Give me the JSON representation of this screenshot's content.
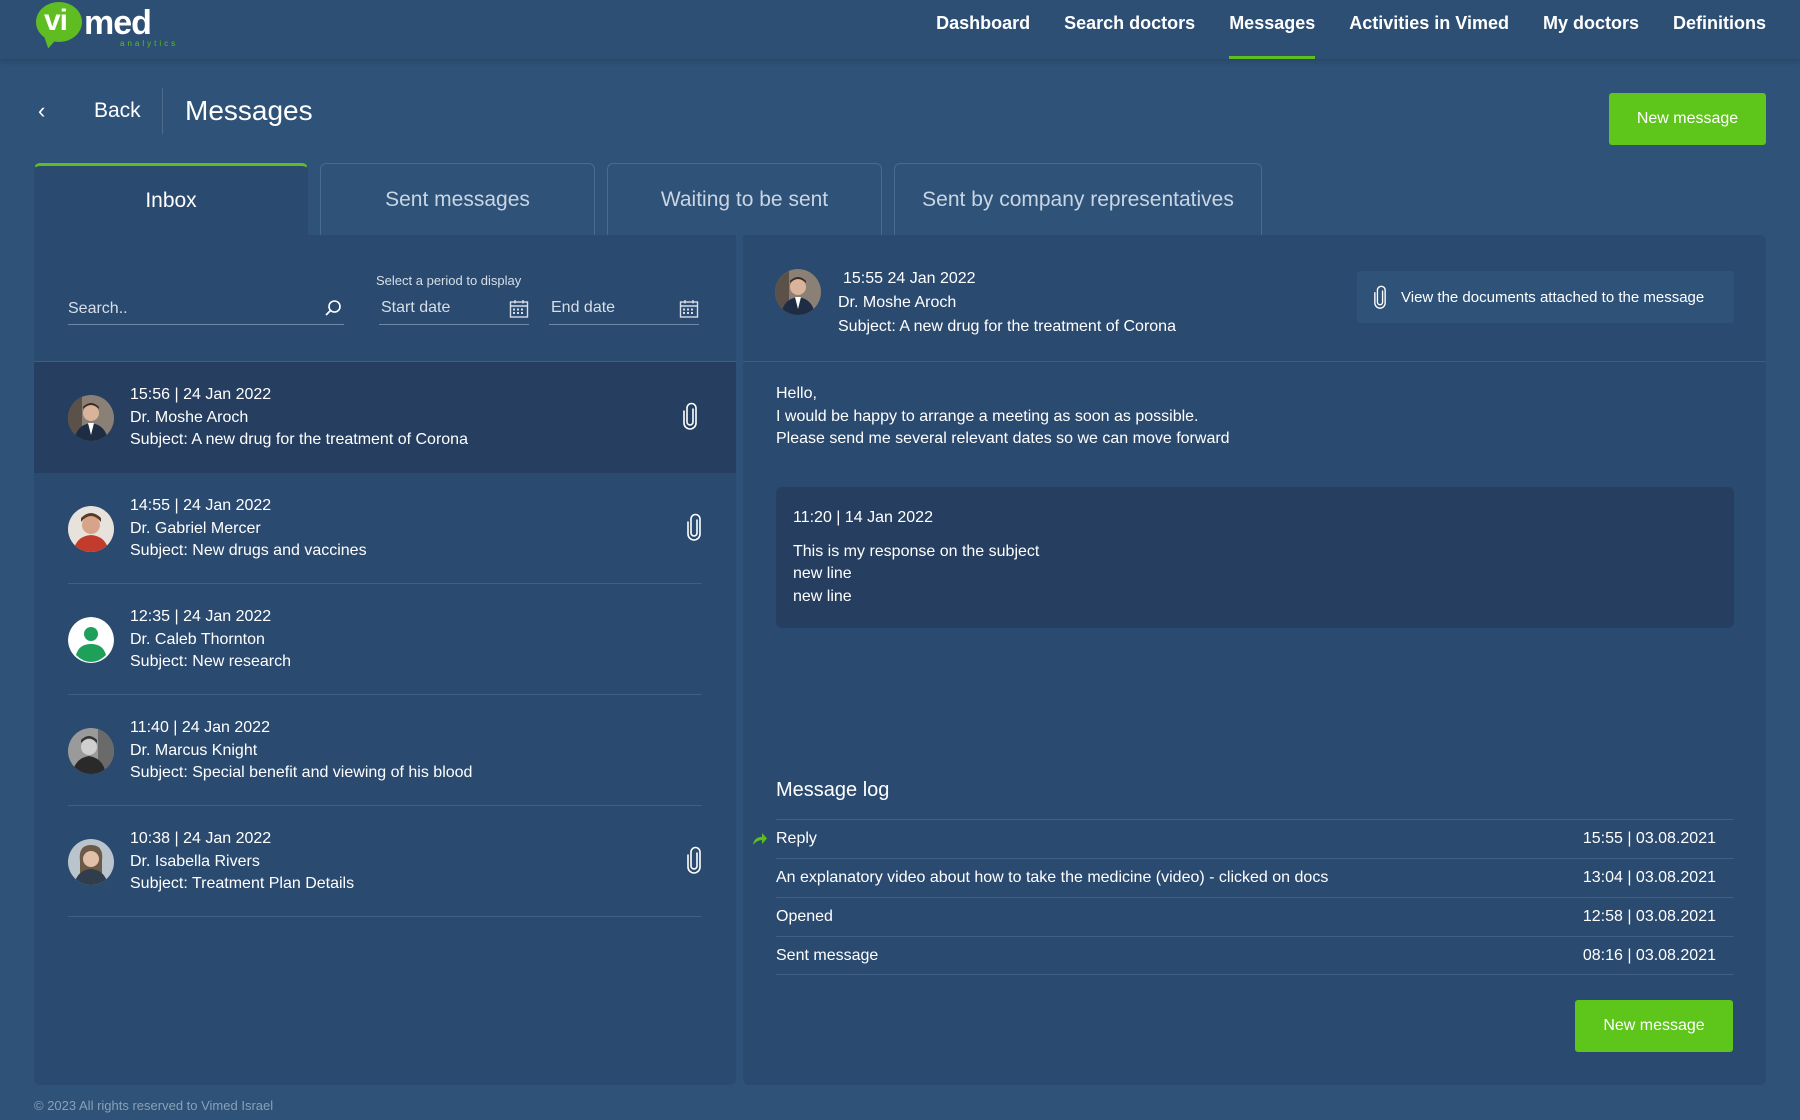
{
  "brand": {
    "logo_vi": "vi",
    "logo_med": "med",
    "logo_sub": "analytics",
    "accent_color": "#5fbd21"
  },
  "nav": {
    "items": [
      {
        "label": "Dashboard"
      },
      {
        "label": "Search doctors"
      },
      {
        "label": "Messages",
        "active": true
      },
      {
        "label": "Activities in Vimed"
      },
      {
        "label": "My doctors"
      },
      {
        "label": "Definitions"
      }
    ]
  },
  "header": {
    "back_label": "Back",
    "title": "Messages",
    "new_message_label": "New message"
  },
  "tabs": [
    {
      "label": "Inbox",
      "active": true
    },
    {
      "label": "Sent messages"
    },
    {
      "label": "Waiting to be sent"
    },
    {
      "label": "Sent by company representatives"
    }
  ],
  "filters": {
    "search_placeholder": "Search..",
    "period_label": "Select a period to display",
    "start_date_placeholder": "Start date",
    "end_date_placeholder": "End date"
  },
  "messages": [
    {
      "time": "15:56  |  24 Jan 2022",
      "doctor": "Dr. Moshe Aroch",
      "subject": "Subject: A new drug for the treatment of Corona",
      "attachment": true,
      "selected": true,
      "avatar": "man-suit"
    },
    {
      "time": "14:55  |  24 Jan 2022",
      "doctor": "Dr. Gabriel Mercer",
      "subject": "Subject: New drugs and vaccines",
      "attachment": true,
      "avatar": "man-red"
    },
    {
      "time": "12:35  |  24 Jan 2022",
      "doctor": "Dr. Caleb Thornton",
      "subject": "Subject:  New research",
      "attachment": false,
      "avatar": "default-user"
    },
    {
      "time": "11:40  |  24 Jan 2022",
      "doctor": "Dr. Marcus Knight",
      "subject": "Subject: Special benefit and viewing of his blood",
      "attachment": false,
      "avatar": "man-bw"
    },
    {
      "time": "10:38  |  24 Jan 2022",
      "doctor": "Dr. Isabella Rivers",
      "subject": "Subject: Treatment Plan Details",
      "attachment": true,
      "avatar": "woman"
    }
  ],
  "detail": {
    "time": "15:55 24 Jan 2022",
    "doctor": "Dr. Moshe Aroch",
    "subject": "Subject: A new drug for the treatment of Corona",
    "attachments_label": "View the documents attached to the message",
    "body": [
      "Hello,",
      "I would be happy to arrange a meeting as soon as possible.",
      "Please send me several relevant dates so we can move forward"
    ],
    "reply": {
      "time": "11:20 | 14 Jan 2022",
      "lines": [
        "This is my response on the subject",
        "new line",
        "new line"
      ]
    }
  },
  "log": {
    "title": "Message log",
    "rows": [
      {
        "event": "Reply",
        "when": "15:55  |  03.08.2021",
        "icon": "reply-arrow-icon"
      },
      {
        "event": "An explanatory video about how to take the medicine (video) - clicked on docs",
        "when": "13:04  |  03.08.2021"
      },
      {
        "event": "Opened",
        "when": "12:58  |  03.08.2021"
      },
      {
        "event": "Sent message",
        "when": "08:16  |  03.08.2021"
      }
    ],
    "new_message_label": "New message"
  },
  "footer": "© 2023 All rights reserved to Vimed Israel"
}
